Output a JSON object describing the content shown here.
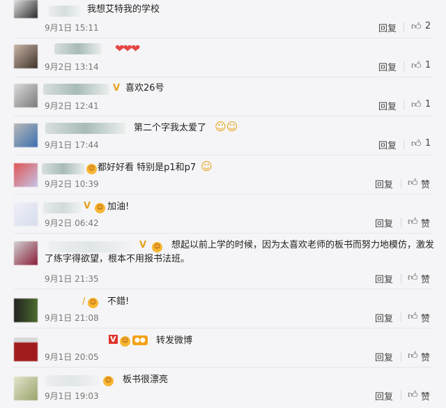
{
  "comments": [
    {
      "text": "我想艾特我的学校",
      "time": "9月1日 15:11",
      "reply": "回复",
      "like": "2"
    },
    {
      "text": "",
      "time": "9月2日 13:14",
      "reply": "回复",
      "like": "1"
    },
    {
      "text": "喜欢26号",
      "time": "9月2日 12:41",
      "reply": "回复",
      "like": "1"
    },
    {
      "text": "第二个字我太爱了",
      "time": "9月1日 17:44",
      "reply": "回复",
      "like": "1"
    },
    {
      "text": "都好好看 特别是p1和p7",
      "time": "9月2日 10:39",
      "reply": "回复",
      "like": "赞"
    },
    {
      "text": "加油!",
      "time": "9月2日 06:42",
      "reply": "回复",
      "like": "赞"
    },
    {
      "text": "想起以前上学的时候，因为太喜欢老师的板书而努力地模仿，激发",
      "text2": "了练字得欲望，根本不用报书法班。",
      "time": "9月1日 21:35",
      "reply": "回复",
      "like": "赞"
    },
    {
      "text": "不錯!",
      "time": "9月1日 21:08",
      "reply": "回复",
      "like": "赞"
    },
    {
      "text": "转发微博",
      "time": "9月1日 20:05",
      "reply": "回复",
      "like": "赞"
    },
    {
      "text": "板书很漂亮",
      "time": "9月1日 19:03",
      "reply": "回复",
      "like": "赞"
    }
  ],
  "icons": {
    "like": "thumbs-up-icon",
    "verified": "v-badge-icon",
    "emoji": "emoji-icon"
  },
  "colors": {
    "heart": "#e64545",
    "verified": "#e3a21a"
  }
}
